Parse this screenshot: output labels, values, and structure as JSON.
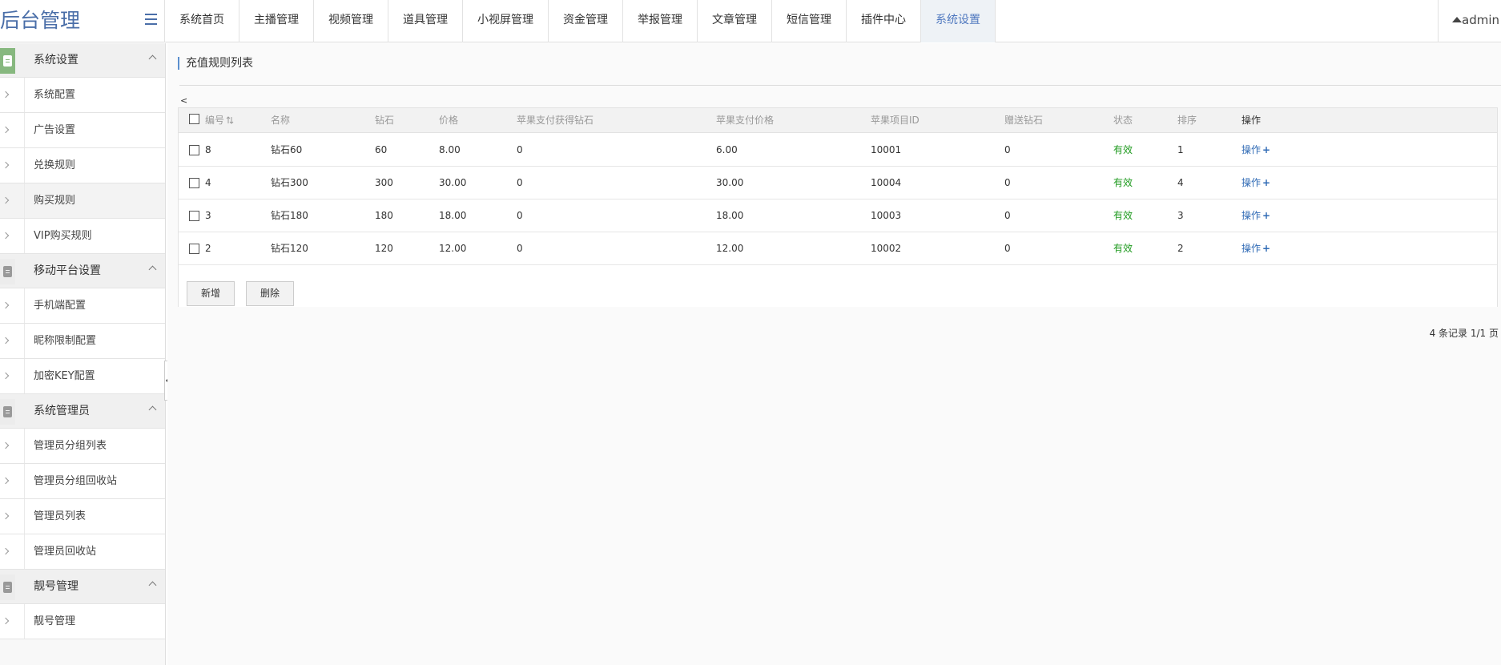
{
  "app": {
    "title": "后台管理",
    "menu_toggle": "menu-icon"
  },
  "nav": {
    "items": [
      "系统首页",
      "主播管理",
      "视频管理",
      "道具管理",
      "小视屏管理",
      "资金管理",
      "举报管理",
      "文章管理",
      "短信管理",
      "插件中心",
      "系统设置"
    ],
    "active": "系统设置"
  },
  "user": {
    "name": "admin",
    "icon": "triangle-up-icon"
  },
  "sidebar": {
    "groups": [
      {
        "label": "系统设置",
        "items": [
          "系统配置",
          "广告设置",
          "兑换规则",
          "购买规则",
          "VIP购买规则"
        ]
      },
      {
        "label": "移动平台设置",
        "items": [
          "手机端配置",
          "昵称限制配置",
          "加密KEY配置"
        ]
      },
      {
        "label": "系统管理员",
        "items": [
          "管理员分组列表",
          "管理员分组回收站",
          "管理员列表",
          "管理员回收站"
        ]
      },
      {
        "label": "靓号管理",
        "items": [
          "靓号管理"
        ]
      }
    ]
  },
  "main": {
    "title": "充值规则列表",
    "back": "<",
    "table": {
      "headers": [
        "编号",
        "名称",
        "钻石",
        "价格",
        "苹果支付获得钻石",
        "苹果支付价格",
        "苹果项目ID",
        "赠送钻石",
        "状态",
        "排序",
        "操作"
      ],
      "rows": [
        {
          "id": "8",
          "name": "钻石60",
          "diamonds": "60",
          "price": "8.00",
          "apple_diamonds": "0",
          "apple_price": "6.00",
          "apple_id": "10001",
          "gift": "0",
          "status": "有效",
          "order": "1",
          "op": "操作"
        },
        {
          "id": "4",
          "name": "钻石300",
          "diamonds": "300",
          "price": "30.00",
          "apple_diamonds": "0",
          "apple_price": "30.00",
          "apple_id": "10004",
          "gift": "0",
          "status": "有效",
          "order": "4",
          "op": "操作"
        },
        {
          "id": "3",
          "name": "钻石180",
          "diamonds": "180",
          "price": "18.00",
          "apple_diamonds": "0",
          "apple_price": "18.00",
          "apple_id": "10003",
          "gift": "0",
          "status": "有效",
          "order": "3",
          "op": "操作"
        },
        {
          "id": "2",
          "name": "钻石120",
          "diamonds": "120",
          "price": "12.00",
          "apple_diamonds": "0",
          "apple_price": "12.00",
          "apple_id": "10002",
          "gift": "0",
          "status": "有效",
          "order": "2",
          "op": "操作"
        }
      ]
    },
    "buttons": {
      "add": "新增",
      "delete": "删除"
    },
    "pager": "4 条记录 1/1 页"
  },
  "colors": {
    "accent": "#4f78bf",
    "status_ok": "#1e9a1e",
    "sidebar_active_icon": "#87b87f",
    "link": "#2f6ab5"
  }
}
